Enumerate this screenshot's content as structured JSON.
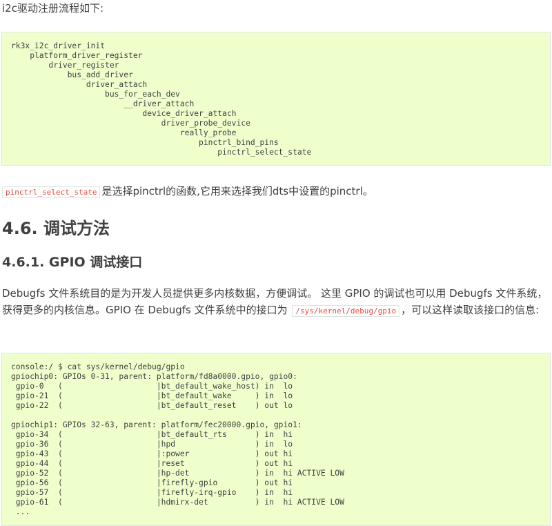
{
  "intro_text": "i2c驱动注册流程如下:",
  "code_block_1": "rk3x_i2c_driver_init\n    platform_driver_register\n        driver_register\n            bus_add_driver\n                driver_attach\n                    bus_for_each_dev\n                        __driver_attach\n                            device_driver_attach\n                                driver_probe_device\n                                    really_probe\n                                        pinctrl_bind_pins\n                                            pinctrl_select_state",
  "select_state": {
    "code": "pinctrl_select_state",
    "text": "是选择pinctrl的函数,它用来选择我们dts中设置的pinctrl。"
  },
  "section_heading": "4.6. 调试方法",
  "subsection_heading": "4.6.1. GPIO 调试接口",
  "debugfs_paragraph": {
    "before": "Debugfs 文件系统目的是为开发人员提供更多内核数据，方便调试。 这里 GPIO 的调试也可以用 Debugfs 文件系统，获得更多的内核信息。GPIO 在 Debugfs 文件系统中的接口为 ",
    "code": "/sys/kernel/debug/gpio",
    "after": "，可以这样读取该接口的信息:"
  },
  "code_block_2": "console:/ $ cat sys/kernel/debug/gpio\ngpiochip0: GPIOs 0-31, parent: platform/fd8a0000.gpio, gpio0:\n gpio-0   (                    |bt_default_wake_host) in  lo\n gpio-21  (                    |bt_default_wake     ) in  lo\n gpio-22  (                    |bt_default_reset    ) out lo\n\ngpiochip1: GPIOs 32-63, parent: platform/fec20000.gpio, gpio1:\n gpio-34  (                    |bt_default_rts      ) in  hi\n gpio-36  (                    |hpd                 ) in  lo\n gpio-43  (                    |:power              ) out hi\n gpio-44  (                    |reset               ) out hi\n gpio-52  (                    |hp-det              ) in  hi ACTIVE LOW\n gpio-56  (                    |firefly-gpio        ) out hi\n gpio-57  (                    |firefly-irq-gpio    ) in  hi\n gpio-61  (                    |hdmirx-det          ) in  hi ACTIVE LOW\n ..."
}
